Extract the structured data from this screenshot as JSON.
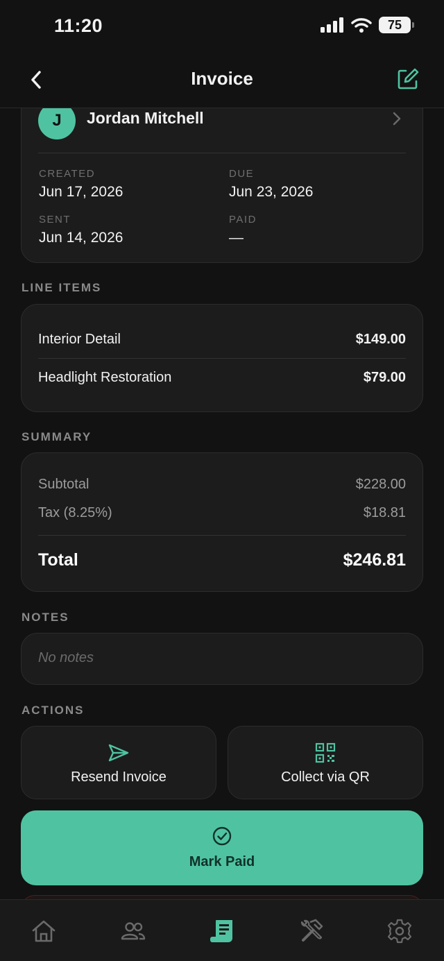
{
  "status": {
    "time": "11:20",
    "battery": "75"
  },
  "nav": {
    "title": "Invoice"
  },
  "client": {
    "initial": "J",
    "name": "Jordan Mitchell"
  },
  "dates": {
    "created_label": "CREATED",
    "created_value": "Jun 17, 2026",
    "due_label": "DUE",
    "due_value": "Jun 23, 2026",
    "sent_label": "SENT",
    "sent_value": "Jun 14, 2026",
    "paid_label": "PAID",
    "paid_value": "—"
  },
  "line_items": {
    "title": "LINE ITEMS",
    "items": [
      {
        "name": "Interior Detail",
        "amount": "$149.00"
      },
      {
        "name": "Headlight Restoration",
        "amount": "$79.00"
      }
    ]
  },
  "summary": {
    "title": "SUMMARY",
    "subtotal_label": "Subtotal",
    "subtotal_value": "$228.00",
    "tax_label": "Tax (8.25%)",
    "tax_value": "$18.81",
    "total_label": "Total",
    "total_value": "$246.81"
  },
  "notes": {
    "title": "NOTES",
    "text": "No notes"
  },
  "actions": {
    "title": "ACTIONS",
    "resend": "Resend Invoice",
    "collect_qr": "Collect via QR",
    "mark_paid": "Mark Paid"
  },
  "tabs": [
    "home-icon",
    "clients-icon",
    "invoices-icon",
    "services-icon",
    "settings-icon"
  ],
  "colors": {
    "accent": "#4fc3a1",
    "background": "#121212",
    "card": "#1c1c1c"
  }
}
